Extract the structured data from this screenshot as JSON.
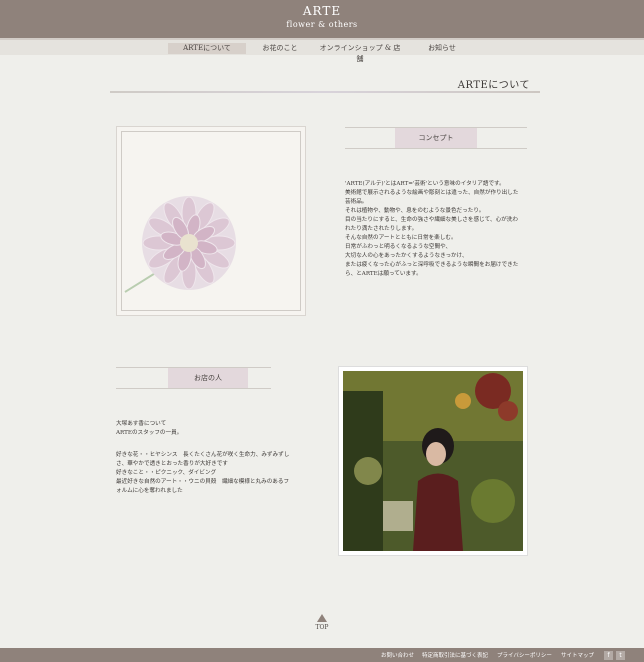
{
  "header": {
    "brand": "ARTE",
    "tagline": "flower & others"
  },
  "nav": {
    "items": [
      {
        "label": "ARTEについて"
      },
      {
        "label": "お花のこと"
      },
      {
        "label": "オンラインショップ & 店舗"
      },
      {
        "label": "お知らせ"
      }
    ]
  },
  "page": {
    "title": "ARTEについて"
  },
  "concept": {
    "heading": "コンセプト",
    "lines": [
      "'ARTE(アルテ)'とはART='芸術'という意味のイタリア語です。",
      "美術館で展示されるような絵画や彫刻とは違った、自然が作り出した",
      "芸術品。",
      "それは植物や、動物や、息をのむような景色だったり。",
      "目の当たりにすると、生命の強さや繊細な美しさを感じて、心が洗わ",
      "れたり満たされたりします。",
      "そんな自然のアートとともに日常を楽しむ。",
      "日常がふわっと明るくなるような空間や、",
      "大切な人の心をあったかくするようなきっかけ、",
      "または疲くなった心がふっと深呼吸できるような瞬間をお届けできた",
      "ら、とARTEは願っています。"
    ]
  },
  "person": {
    "heading": "お店の人",
    "intro": [
      "大塚あす香について",
      "ARTEのスタッフの一員。"
    ],
    "details": [
      "好きな花・・ヒヤシンス　長くたくさん花が咲く生命力、みずみずし",
      "さ、華やかで透きとおった香りが大好きです",
      "好きなこと・・ピクニック、ダイビング",
      "最近好きな自然のアート・・ウニの貝殻　繊細な模様と丸みのあるフ",
      "ォルムに心を奪われました"
    ]
  },
  "to_top": {
    "label": "TOP"
  },
  "footer": {
    "links": [
      "お問い合わせ",
      "特定商取引法に基づく表記",
      "プライバシーポリシー",
      "サイトマップ"
    ],
    "social": [
      {
        "icon": "facebook-icon",
        "glyph": "f"
      },
      {
        "icon": "twitter-icon",
        "glyph": "t"
      }
    ]
  }
}
